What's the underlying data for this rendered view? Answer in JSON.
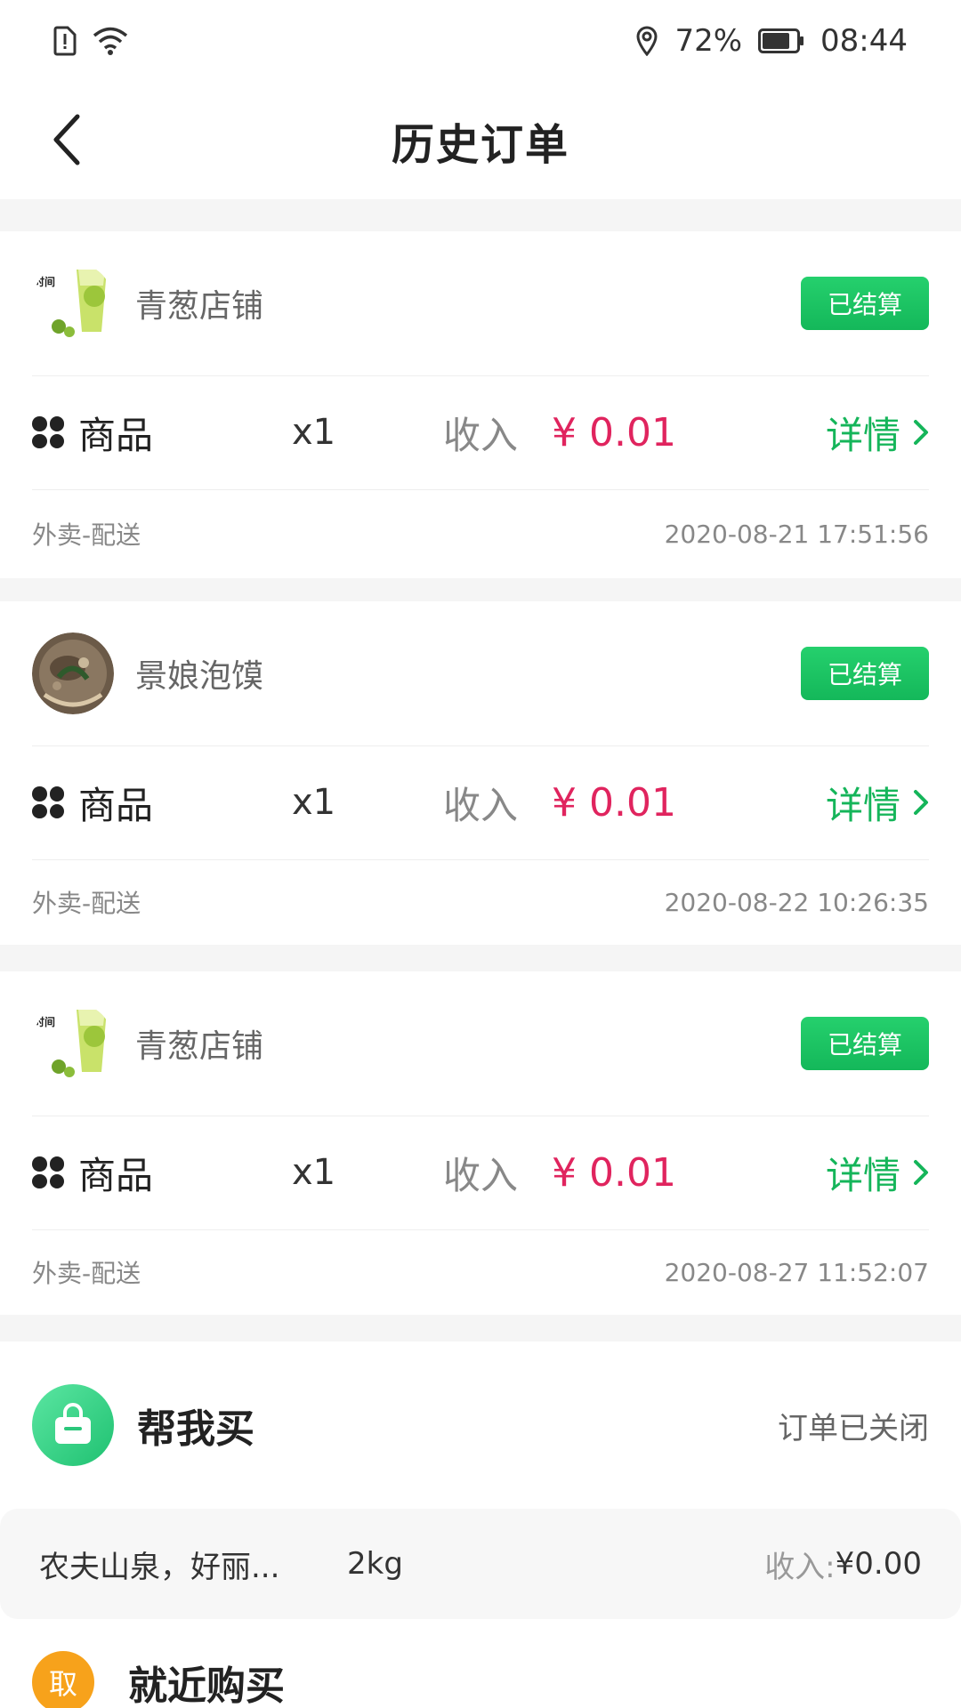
{
  "status_bar": {
    "battery": "72%",
    "time": "08:44"
  },
  "header": {
    "title": "历史订单"
  },
  "orders": [
    {
      "shop_name": "青葱店铺",
      "shop_logo": "juice-cup-logo",
      "status": "已结算",
      "goods_label": "商品",
      "quantity": "x1",
      "income_label": "收入",
      "income_value": "¥ 0.01",
      "detail_label": "详情",
      "order_type": "外卖-配送",
      "timestamp": "2020-08-21 17:51:56"
    },
    {
      "shop_name": "景娘泡馍",
      "shop_logo": "food-bowl-photo",
      "status": "已结算",
      "goods_label": "商品",
      "quantity": "x1",
      "income_label": "收入",
      "income_value": "¥ 0.01",
      "detail_label": "详情",
      "order_type": "外卖-配送",
      "timestamp": "2020-08-22 10:26:35"
    },
    {
      "shop_name": "青葱店铺",
      "shop_logo": "juice-cup-logo",
      "status": "已结算",
      "goods_label": "商品",
      "quantity": "x1",
      "income_label": "收入",
      "income_value": "¥ 0.01",
      "detail_label": "详情",
      "order_type": "外卖-配送",
      "timestamp": "2020-08-27 11:52:07"
    }
  ],
  "errand": {
    "icon": "shopping-bag-icon",
    "title": "帮我买",
    "status": "订单已关闭",
    "goods_name": "农夫山泉，好丽...",
    "goods_weight": "2kg",
    "income_label": "收入:",
    "income_value": "¥0.00",
    "pickup_badge": "取",
    "nearby_title": "就近购买"
  },
  "colors": {
    "brand_green": "#15b55a",
    "price_red": "#e0245e",
    "pickup_orange": "#f7a21b"
  }
}
